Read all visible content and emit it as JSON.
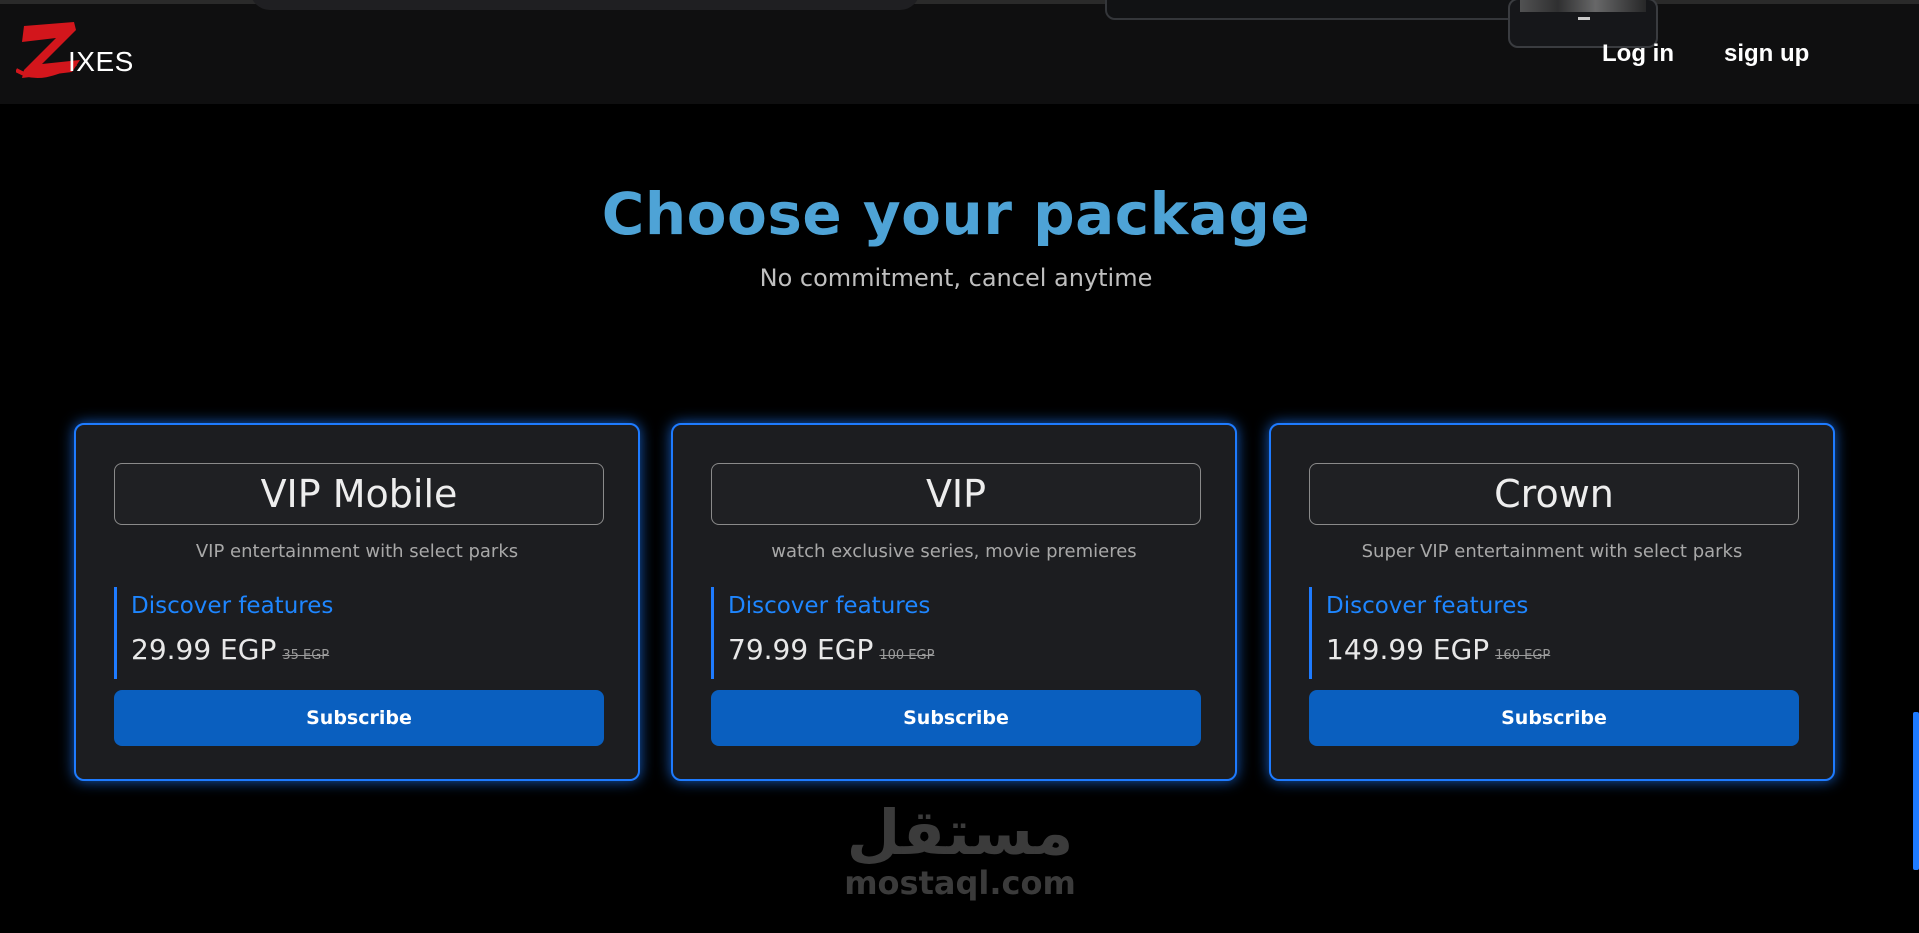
{
  "brand": {
    "logo_text": "IXES",
    "logo_icon": "z-logo-icon",
    "accent_color": "#1e7bff"
  },
  "nav": {
    "login_label": "Log in",
    "signup_label": "sign up"
  },
  "hero": {
    "title": "Choose your package",
    "subtitle": "No commitment, cancel anytime",
    "title_color": "#4ea3d6"
  },
  "packages": [
    {
      "name": "VIP Mobile",
      "description": "VIP entertainment with select parks",
      "features_label": "Discover features",
      "price": "29.99 EGP",
      "old_price": "35 EGP",
      "button_label": "Subscribe"
    },
    {
      "name": "VIP",
      "description": "watch exclusive series, movie premieres",
      "features_label": "Discover features",
      "price": "79.99 EGP",
      "old_price": "100 EGP",
      "button_label": "Subscribe"
    },
    {
      "name": "Crown",
      "description": "Super VIP entertainment with select parks",
      "features_label": "Discover features",
      "price": "149.99 EGP",
      "old_price": "160 EGP",
      "button_label": "Subscribe"
    }
  ],
  "watermark": {
    "arabic": "مستقل",
    "latin": "mostaql.com"
  }
}
